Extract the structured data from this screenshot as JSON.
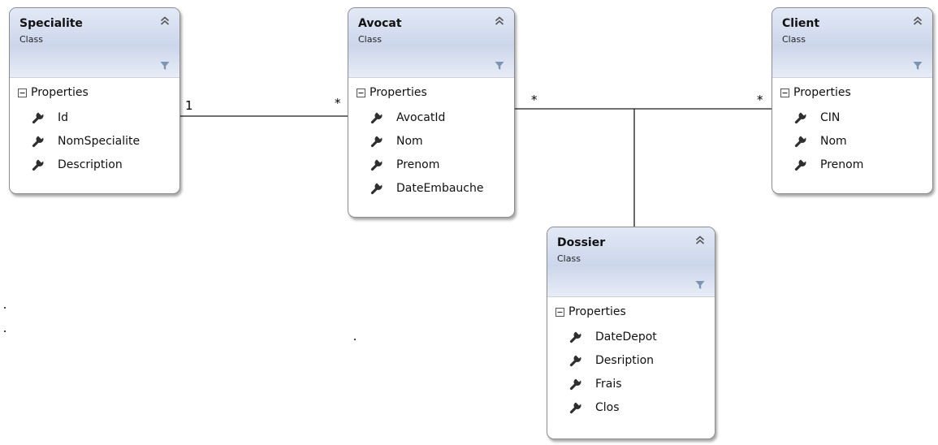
{
  "diagram": {
    "classes": [
      {
        "id": "specialite",
        "name": "Specialite",
        "stereotype": "Class",
        "section": "Properties",
        "properties": [
          "Id",
          "NomSpecialite",
          "Description"
        ]
      },
      {
        "id": "avocat",
        "name": "Avocat",
        "stereotype": "Class",
        "section": "Properties",
        "properties": [
          "AvocatId",
          "Nom",
          "Prenom",
          "DateEmbauche"
        ]
      },
      {
        "id": "client",
        "name": "Client",
        "stereotype": "Class",
        "section": "Properties",
        "properties": [
          "CIN",
          "Nom",
          "Prenom"
        ]
      },
      {
        "id": "dossier",
        "name": "Dossier",
        "stereotype": "Class",
        "section": "Properties",
        "properties": [
          "DateDepot",
          "Desription",
          "Frais",
          "Clos"
        ]
      }
    ],
    "associations": [
      {
        "from": "specialite",
        "to": "avocat",
        "from_multiplicity": "1",
        "to_multiplicity": "*"
      },
      {
        "from": "avocat",
        "to": "client",
        "from_multiplicity": "*",
        "to_multiplicity": "*",
        "association_class": "dossier"
      }
    ],
    "icons": {
      "collapse": "double-chevron-up-icon",
      "filter": "funnel-icon",
      "section_toggle": "minus-box-icon",
      "property": "wrench-icon"
    },
    "colors": {
      "header_gradient_top": "#e2e9f6",
      "header_gradient_mid": "#ccd6eb",
      "border": "#8d8d8d",
      "filter_icon": "#7e93b0",
      "connector": "#1a1a1a"
    }
  }
}
